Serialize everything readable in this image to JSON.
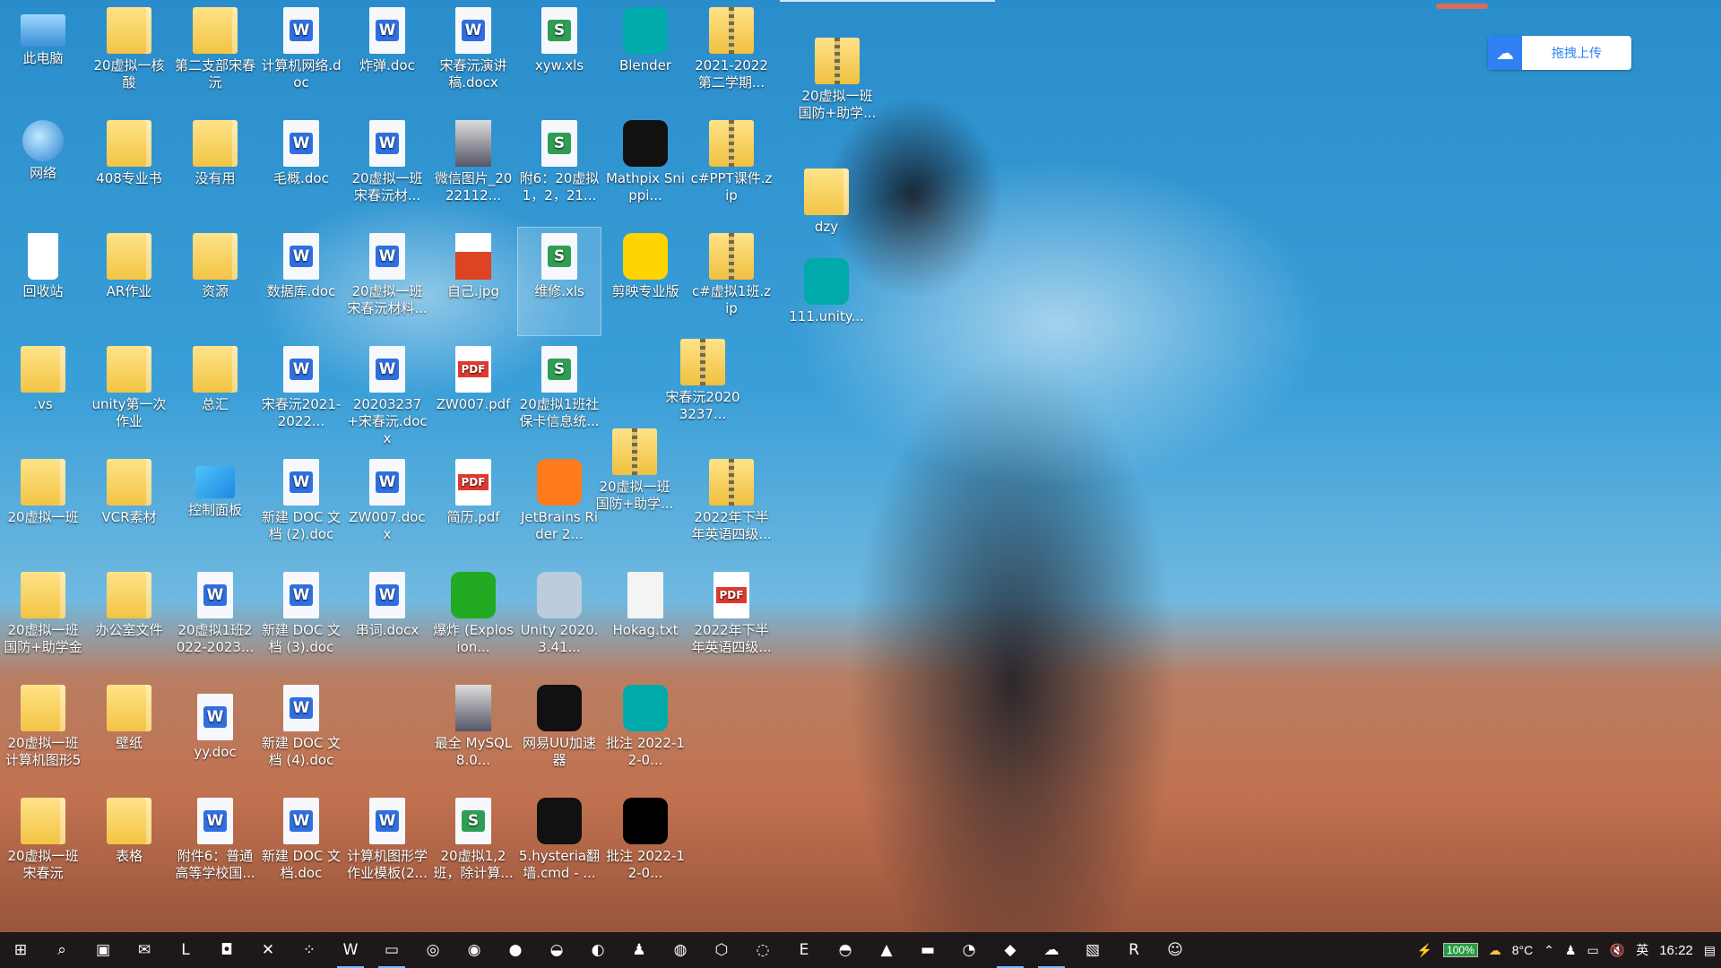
{
  "upload": {
    "label": "拖拽上传"
  },
  "desktop_icons": [
    {
      "label": "此电脑",
      "kind": "pc"
    },
    {
      "label": "20虚拟一核酸",
      "kind": "folder"
    },
    {
      "label": "第二支部宋春沅",
      "kind": "folder"
    },
    {
      "label": "计算机网络.doc",
      "kind": "doc"
    },
    {
      "label": "炸弹.doc",
      "kind": "doc"
    },
    {
      "label": "宋春沅演讲稿.docx",
      "kind": "doc"
    },
    {
      "label": "xyw.xls",
      "kind": "xls"
    },
    {
      "label": "Blender",
      "kind": "app"
    },
    {
      "label": "2021-2022第二学期...",
      "kind": "zip"
    },
    {
      "label": "20虚拟一班国防+助学...",
      "kind": "zip"
    },
    {
      "label": "网络",
      "kind": "net"
    },
    {
      "label": "408专业书",
      "kind": "folder"
    },
    {
      "label": "没有用",
      "kind": "folder"
    },
    {
      "label": "毛概.doc",
      "kind": "doc"
    },
    {
      "label": "20虚拟一班宋春沅材...",
      "kind": "doc"
    },
    {
      "label": "微信图片_2022112...",
      "kind": "image"
    },
    {
      "label": "附6：20虚拟1，2，21...",
      "kind": "xls"
    },
    {
      "label": "Mathpix Snippi...",
      "kind": "app"
    },
    {
      "label": "c#PPT课件.zip",
      "kind": "zip"
    },
    {
      "label": "dzy",
      "kind": "folder"
    },
    {
      "label": "回收站",
      "kind": "bin"
    },
    {
      "label": "AR作业",
      "kind": "folder"
    },
    {
      "label": "资源",
      "kind": "folder"
    },
    {
      "label": "数据库.doc",
      "kind": "doc"
    },
    {
      "label": "20虚拟一班宋春沅材料...",
      "kind": "doc"
    },
    {
      "label": "自己.jpg",
      "kind": "avatar"
    },
    {
      "label": "维修.xls",
      "kind": "xls"
    },
    {
      "label": "剪映专业版",
      "kind": "app"
    },
    {
      "label": "c#虚拟1班.zip",
      "kind": "zip"
    },
    {
      "label": "111.unity...",
      "kind": "app"
    },
    {
      "label": ".vs",
      "kind": "folder"
    },
    {
      "label": "unity第一次作业",
      "kind": "folder"
    },
    {
      "label": "总汇",
      "kind": "folder"
    },
    {
      "label": "宋春沅2021-2022...",
      "kind": "doc"
    },
    {
      "label": "20203237+宋春沅.docx",
      "kind": "doc"
    },
    {
      "label": "ZW007.pdf",
      "kind": "pdf"
    },
    {
      "label": "20虚拟1班社保卡信息统...",
      "kind": "xls"
    },
    {
      "label": "宋春沅20203237...",
      "kind": "zip"
    },
    {
      "label": "20虚拟一班",
      "kind": "folder"
    },
    {
      "label": "VCR素材",
      "kind": "folder"
    },
    {
      "label": "控制面板",
      "kind": "cp"
    },
    {
      "label": "新建 DOC 文档 (2).doc",
      "kind": "doc"
    },
    {
      "label": "ZW007.docx",
      "kind": "doc"
    },
    {
      "label": "简历.pdf",
      "kind": "pdf"
    },
    {
      "label": "JetBrains Rider 2...",
      "kind": "app"
    },
    {
      "label": "20虚拟一班国防+助学...",
      "kind": "zip"
    },
    {
      "label": "2022年下半年英语四级...",
      "kind": "zip"
    },
    {
      "label": "20虚拟一班国防+助学金",
      "kind": "folder"
    },
    {
      "label": "办公室文件",
      "kind": "folder"
    },
    {
      "label": "20虚拟1班2022-2023...",
      "kind": "doc"
    },
    {
      "label": "新建 DOC 文档 (3).doc",
      "kind": "doc"
    },
    {
      "label": "串词.docx",
      "kind": "doc"
    },
    {
      "label": "爆炸 (Explosion...",
      "kind": "app"
    },
    {
      "label": "Unity 2020.3.41...",
      "kind": "app"
    },
    {
      "label": "Hokag.txt",
      "kind": "txt"
    },
    {
      "label": "2022年下半年英语四级...",
      "kind": "pdf"
    },
    {
      "label": "20虚拟一班计算机图形5",
      "kind": "folder"
    },
    {
      "label": "壁纸",
      "kind": "folder"
    },
    {
      "label": "yy.doc",
      "kind": "doc"
    },
    {
      "label": "新建 DOC 文档 (4).doc",
      "kind": "doc"
    },
    {
      "label": "最全 MySQL8.0...",
      "kind": "image"
    },
    {
      "label": "网易UU加速器",
      "kind": "app"
    },
    {
      "label": "批注 2022-12-0...",
      "kind": "app"
    },
    {
      "label": "20虚拟一班宋春沅",
      "kind": "folder"
    },
    {
      "label": "表格",
      "kind": "folder"
    },
    {
      "label": "附件6：普通高等学校国...",
      "kind": "doc"
    },
    {
      "label": "新建 DOC 文档.doc",
      "kind": "doc"
    },
    {
      "label": "计算机图形学作业模板(2...",
      "kind": "doc"
    },
    {
      "label": "20虚拟1,2班，除计算...",
      "kind": "xls"
    },
    {
      "label": "5.hysteria翻墙.cmd - ...",
      "kind": "app"
    },
    {
      "label": "批注 2022-12-0...",
      "kind": "app"
    }
  ],
  "taskbar": {
    "apps": [
      {
        "name": "start-icon",
        "glyph": "⊞"
      },
      {
        "name": "search-icon",
        "glyph": "⌕"
      },
      {
        "name": "store-icon",
        "glyph": "▣"
      },
      {
        "name": "mail-icon",
        "glyph": "✉"
      },
      {
        "name": "app-l-icon",
        "glyph": "L"
      },
      {
        "name": "office-icon",
        "glyph": "◘"
      },
      {
        "name": "xmind-icon",
        "glyph": "✕"
      },
      {
        "name": "app-dots-icon",
        "glyph": "⁘"
      },
      {
        "name": "word-icon",
        "glyph": "W"
      },
      {
        "name": "file-explorer-icon",
        "glyph": "▭"
      },
      {
        "name": "search-app-icon",
        "glyph": "◎"
      },
      {
        "name": "wechat-icon",
        "glyph": "◉"
      },
      {
        "name": "chrome-icon",
        "glyph": "●"
      },
      {
        "name": "app-ball-icon",
        "glyph": "◒"
      },
      {
        "name": "edge-icon",
        "glyph": "◐"
      },
      {
        "name": "qq-icon",
        "glyph": "♟"
      },
      {
        "name": "netease-music-icon",
        "glyph": "◍"
      },
      {
        "name": "cube-icon",
        "glyph": "⬡"
      },
      {
        "name": "uu-icon",
        "glyph": "◌"
      },
      {
        "name": "epic-icon",
        "glyph": "E"
      },
      {
        "name": "steam-icon",
        "glyph": "◓"
      },
      {
        "name": "mountain-app-icon",
        "glyph": "▲"
      },
      {
        "name": "terminal-icon",
        "glyph": "▬"
      },
      {
        "name": "github-icon",
        "glyph": "◔"
      },
      {
        "name": "unity-icon",
        "glyph": "◆"
      },
      {
        "name": "baidu-netdisk-icon",
        "glyph": "☁"
      },
      {
        "name": "photos-icon",
        "glyph": "▧"
      },
      {
        "name": "rider-icon",
        "glyph": "R"
      },
      {
        "name": "chatbot-icon",
        "glyph": "☺"
      }
    ],
    "battery": "100%",
    "weather_temp": "8°C",
    "ime": "英",
    "time": "16:22"
  }
}
